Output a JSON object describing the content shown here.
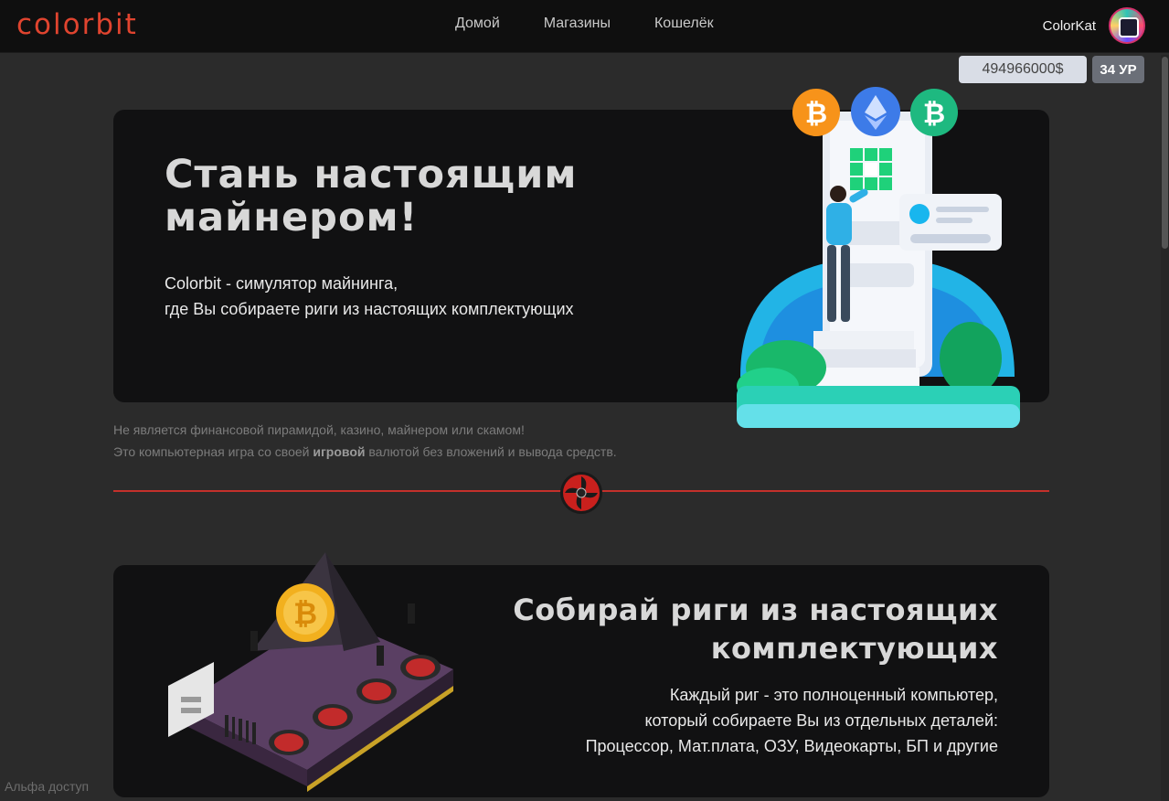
{
  "brand": {
    "logo_text": "colorbit",
    "accent": "#e0442f"
  },
  "nav": {
    "items": [
      "Домой",
      "Магазины",
      "Кошелёк"
    ]
  },
  "user": {
    "name": "ColorKat",
    "balance": "494966000$",
    "level": "34 УР"
  },
  "hero": {
    "title_lines": [
      "Стань настоящим",
      "майнером!"
    ],
    "subtitle_lines": [
      "Colorbit - симулятор майнинга,",
      "где Вы собираете риги из настоящих комплектующих"
    ]
  },
  "disclaimer": {
    "line1": "Не является финансовой пирамидой, казино, майнером или скамом!",
    "line2_pre": "Это компьютерная игра со своей ",
    "line2_bold": "игровой",
    "line2_post": " валютой без вложений и вывода средств."
  },
  "feature": {
    "title_lines": [
      "Собирай риги из настоящих",
      "комплектующих"
    ],
    "text_lines": [
      "Каждый риг - это полноценный компьютер,",
      "который собираете Вы из отдельных деталей:",
      "Процессор, Мат.плата, ОЗУ, Видеокарты, БП и другие"
    ]
  },
  "footer": {
    "alpha_label": "Альфа доступ"
  },
  "icons": [
    "bitcoin-icon",
    "ethereum-icon",
    "bitcoin-cash-icon",
    "fan-icon",
    "avatar"
  ],
  "colors": {
    "background": "#2b2b2b",
    "card": "#111112",
    "divider": "#c4302b",
    "balance_bg": "#d9dde6",
    "level_bg": "#6b6f78"
  }
}
